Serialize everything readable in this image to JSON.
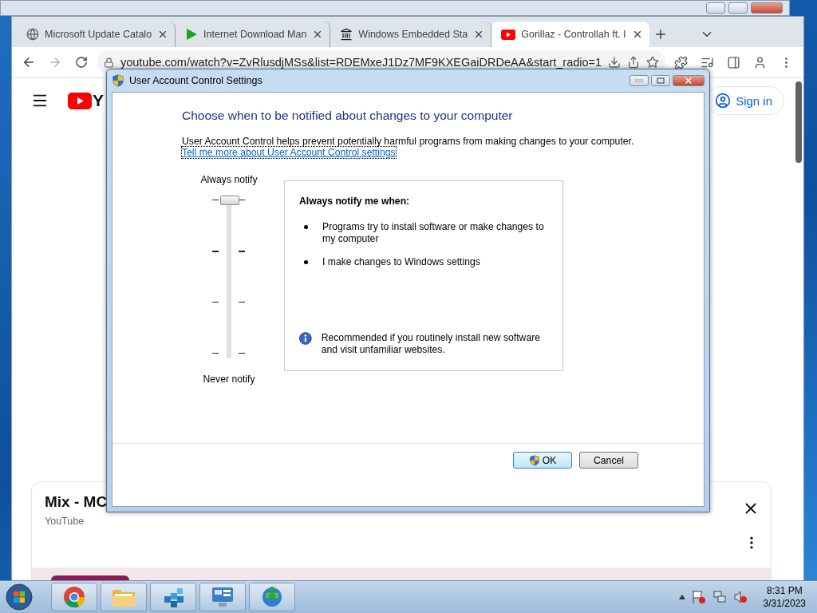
{
  "browser": {
    "tabs": [
      {
        "kind": "globe",
        "title": "Microsoft Update Catalo",
        "selected": false
      },
      {
        "kind": "play",
        "title": "Internet Download Man",
        "selected": false
      },
      {
        "kind": "building",
        "title": "Windows Embedded Sta",
        "selected": false
      },
      {
        "kind": "youtube",
        "title": "Gorillaz - Controllah ft. I",
        "selected": true
      }
    ],
    "address": "youtube.com/watch?v=ZvRlusdjMSs&list=RDEMxeJ1Dz7MF9KXEGaiDRDeAA&start_radio=1",
    "page": {
      "logo_text": "Y",
      "sign_in": "Sign in",
      "card": {
        "title": "Mix - MC",
        "subtitle": "YouTube"
      }
    }
  },
  "dialog": {
    "title": "User Account Control Settings",
    "heading": "Choose when to be notified about changes to your computer",
    "description": "User Account Control helps prevent potentially harmful programs from making changes to your computer.",
    "link": "Tell me more about User Account Control settings",
    "slider": {
      "top_label": "Always notify",
      "bottom_label": "Never notify",
      "level": 1
    },
    "info": {
      "title": "Always notify me when:",
      "bullets": [
        "Programs try to install software or make changes to my computer",
        "I make changes to Windows settings"
      ],
      "note": "Recommended if you routinely install new software and visit unfamiliar websites."
    },
    "buttons": [
      {
        "kind": "ok",
        "label": "OK"
      },
      {
        "kind": "cancel",
        "label": "Cancel"
      }
    ]
  },
  "taskbar": {
    "apps": [
      {
        "kind": "chrome"
      },
      {
        "kind": "explorer"
      },
      {
        "kind": "registry"
      },
      {
        "kind": "control-panel"
      },
      {
        "kind": "idm"
      }
    ],
    "time": "8:31 PM",
    "date": "3/31/2023"
  }
}
